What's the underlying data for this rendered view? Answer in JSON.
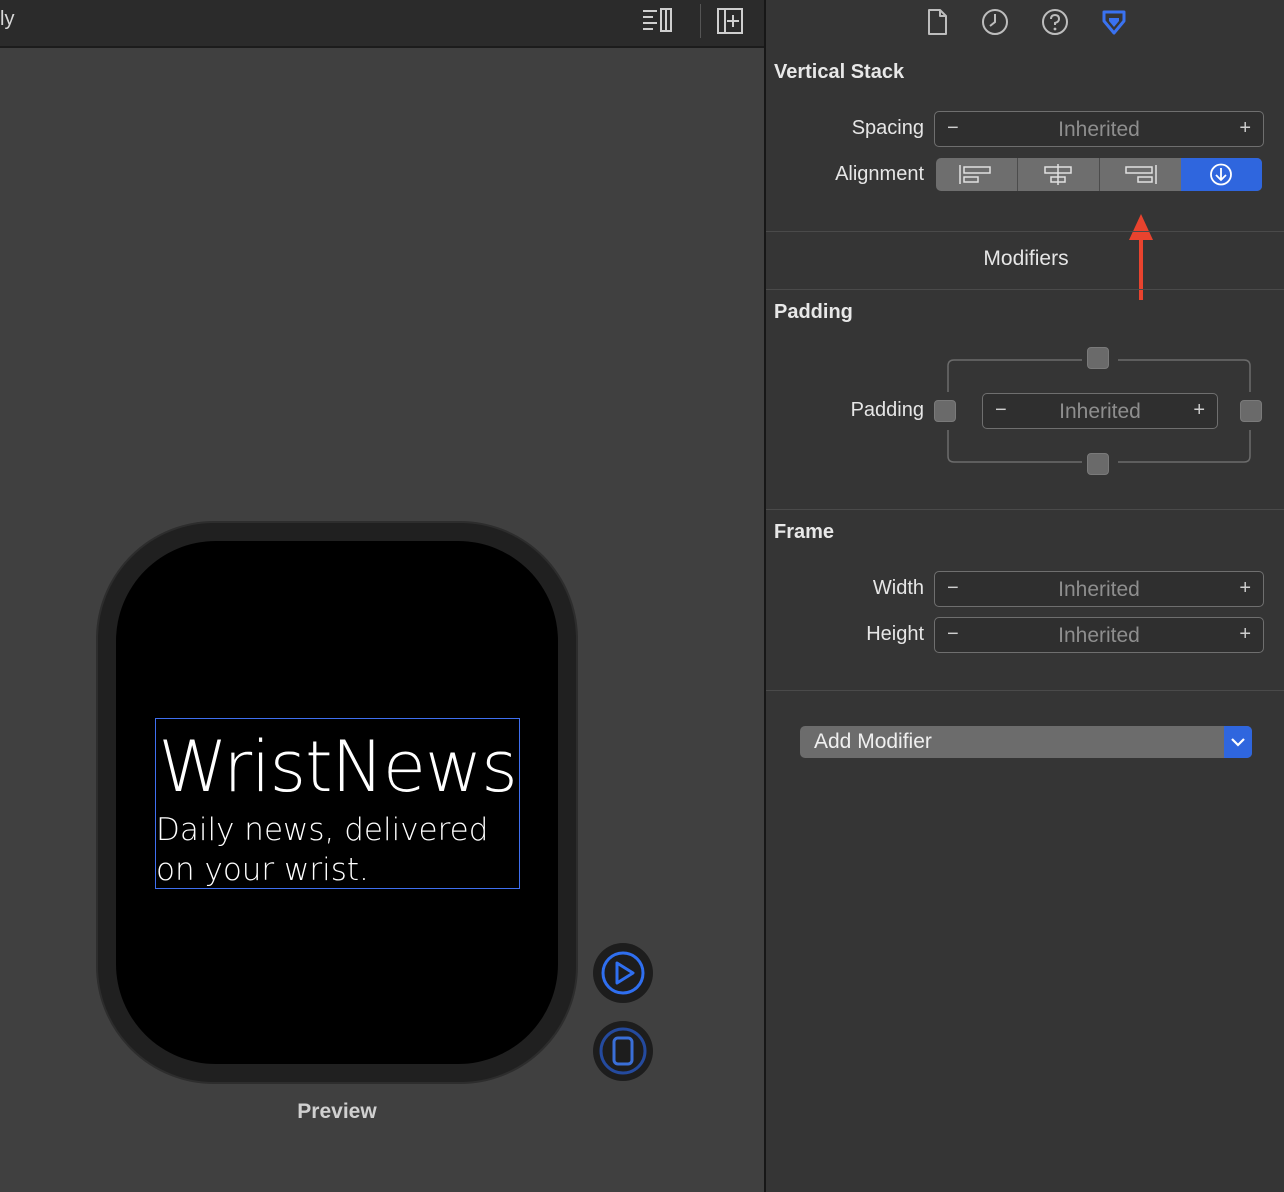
{
  "canvas": {
    "topbar_title": "ly",
    "watch": {
      "title": "WristNews",
      "subtitle": "Daily news, delivered on your wrist."
    },
    "preview_label": "Preview"
  },
  "inspector": {
    "tabs": [
      "file-icon",
      "history-icon",
      "help-icon",
      "attributes-icon"
    ],
    "vertical_stack": {
      "title": "Vertical Stack",
      "spacing_label": "Spacing",
      "spacing_value": "Inherited",
      "alignment_label": "Alignment",
      "alignment_options": [
        "leading",
        "center",
        "trailing",
        "inherited"
      ],
      "alignment_selected": "inherited"
    },
    "modifiers_label": "Modifiers",
    "padding": {
      "title": "Padding",
      "label": "Padding",
      "value": "Inherited"
    },
    "frame": {
      "title": "Frame",
      "width_label": "Width",
      "width_value": "Inherited",
      "height_label": "Height",
      "height_value": "Inherited"
    },
    "add_modifier_label": "Add Modifier",
    "stepper_minus": "−",
    "stepper_plus": "+"
  },
  "colors": {
    "accent": "#2f66de",
    "arrow_annotation": "#e8432e",
    "selection": "#3f6ff0"
  }
}
